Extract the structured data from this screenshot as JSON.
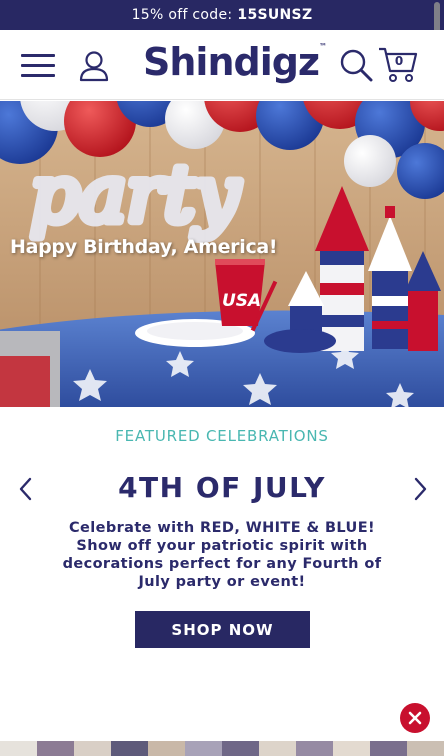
{
  "promo": {
    "text": "15% off code:",
    "code": "15SUNSZ"
  },
  "header": {
    "logo": "Shindigz",
    "logo_mark": "™",
    "cart_count": "0"
  },
  "hero": {
    "caption": "Happy Birthday, America!",
    "balloon_word": "party",
    "cup_text": "USA"
  },
  "featured": {
    "eyebrow": "FEATURED CELEBRATIONS",
    "title": "4TH OF JULY",
    "description": "Celebrate with RED, WHITE & BLUE! Show off your patriotic spirit with decorations perfect for any Fourth of July party or event!",
    "button": "SHOP NOW"
  },
  "icons": {
    "menu": "hamburger-icon",
    "account": "user-icon",
    "search": "search-icon",
    "cart": "cart-icon",
    "prev": "chevron-left-icon",
    "next": "chevron-right-icon",
    "close": "close-icon"
  },
  "colors": {
    "brand": "#2b2a6b",
    "promo_bg": "#282863",
    "eyebrow": "#49b7b1",
    "close_button": "#c8102e"
  }
}
